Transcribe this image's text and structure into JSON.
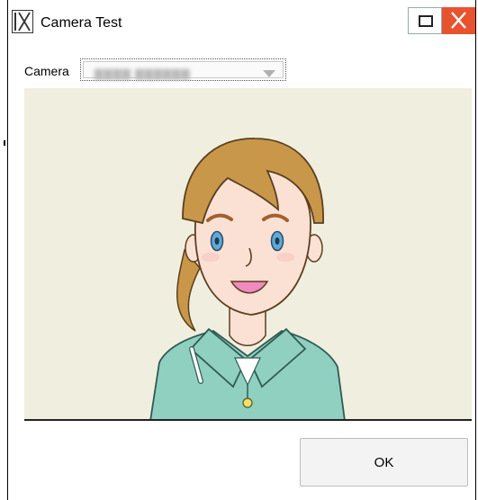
{
  "window": {
    "title": "Camera Test",
    "app_icon": "ix-logo-icon",
    "buttons": {
      "maximize": "maximize-icon",
      "close": "close-icon"
    },
    "close_color": "#e8532f"
  },
  "camera": {
    "label": "Camera",
    "selected_value": "▇▇▇▇ ▇▇▇▇▇▇"
  },
  "preview": {
    "background": "#f0eedf"
  },
  "footer": {
    "ok_label": "OK"
  }
}
